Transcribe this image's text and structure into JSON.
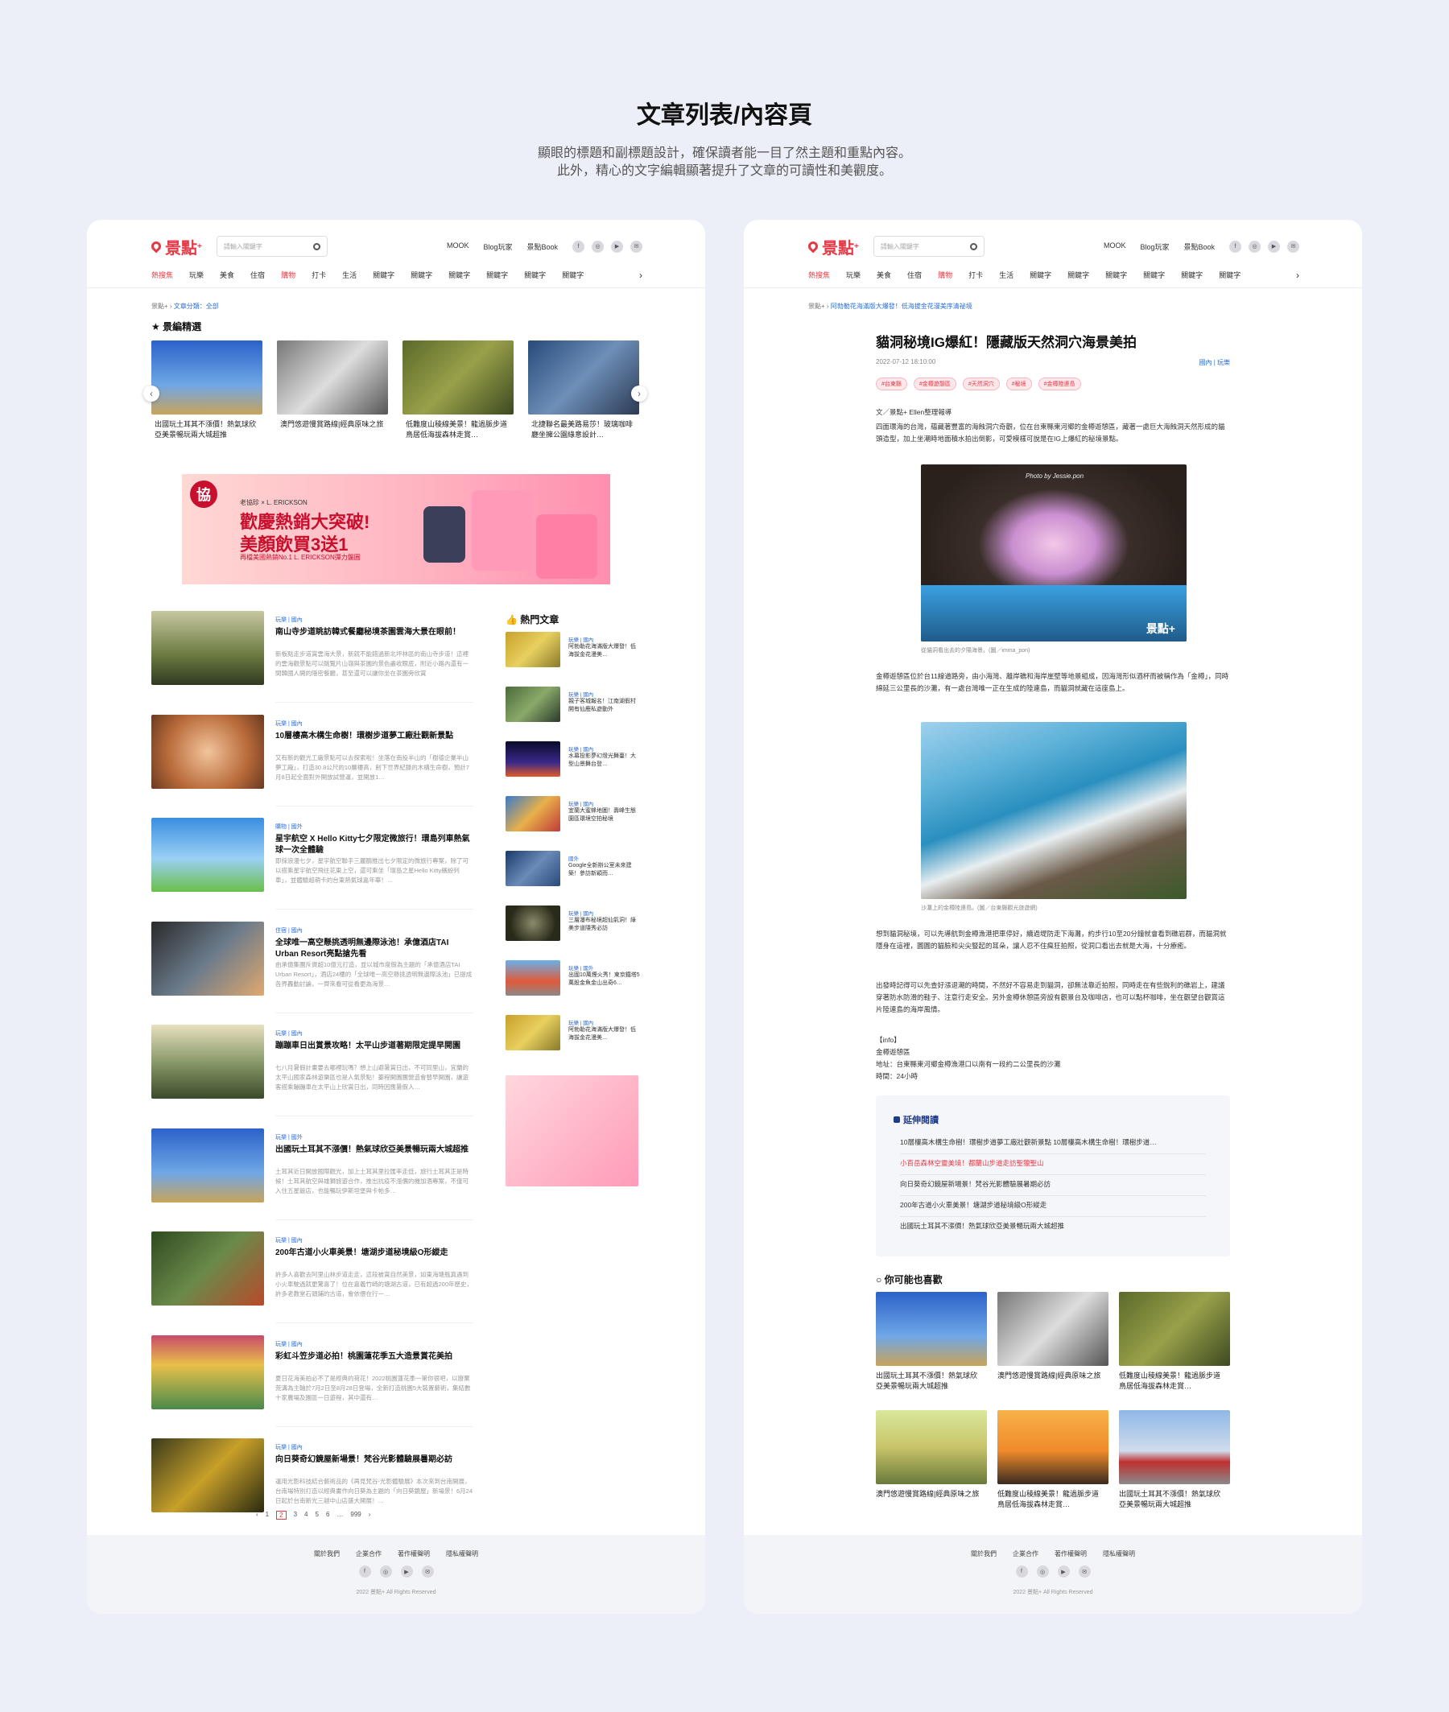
{
  "header": {
    "title": "文章列表/內容頁",
    "desc_line1": "顯眼的標題和副標題設計，確保讀者能一目了然主題和重點內容。",
    "desc_line2": "此外，精心的文字編輯顯著提升了文章的可讀性和美觀度。"
  },
  "site": {
    "logo": "景點",
    "logo_sup": "+",
    "search_placeholder": "請輸入關鍵字",
    "nav_links": [
      "MOOK",
      "Blog玩家",
      "景點Book"
    ],
    "socials": [
      "f",
      "◎",
      "▶",
      "✉"
    ],
    "tabs": [
      "熱搜焦",
      "玩樂",
      "美食",
      "住宿",
      "購物",
      "打卡",
      "生活",
      "關鍵字",
      "關鍵字",
      "關鍵字",
      "關鍵字",
      "關鍵字",
      "關鍵字"
    ],
    "more": "›"
  },
  "list_page": {
    "crumb_home": "景點+",
    "crumb_current": "文章分類：全部",
    "featured_title": "★ 景編精選",
    "featured": [
      "出國玩土耳其不漲價！熱氣球欣亞美景暢玩兩大城超推",
      "澳門悠遊慢賞路線|經典原味之旅",
      "低難度山稜線美景！龍過脈步道鳥居低海拔森林走賞…",
      "北捷聯名最美路易莎！玻璃咖啡廳坐擁公園綠意設計…"
    ],
    "banner": {
      "logo": "協",
      "brand": "老協珍 × L. ERICKSON",
      "line1": "歡慶熱銷大突破!",
      "line2": "美顏飲買3送1",
      "line3": "再檔美國熱銷No.1 L. ERICKSON彈力盤圓"
    },
    "articles": [
      {
        "meta": "玩樂 | 國內",
        "title": "南山寺步道眺訪韓式餐廳秘境茶園雲海大景在眼前！",
        "excerpt": "新板點走步道賞雲海大景，新就不能錯過新北坪林區的南山寺步道！這裡的雲海觀景點可以眺覽片山嶺與茶園的景色盡收眼底，附近小路內還有一間韓國人開的隱密餐廳，甚至還可以讓你坐在茶園旁欣賞"
      },
      {
        "meta": "玩樂 | 國內",
        "title": "10層樓高木構生命樹！環樹步道夢工廠壯觀新景點",
        "excerpt": "又有新的觀光工廠景點可以去探索啦！坐落在南投半山的「樹德企業半山夢工廠」，打造30.8公尺的10層樓高，創下世界紀錄的木構生命樹，預計7月8日起全面對外開放試營運，並開放1…"
      },
      {
        "meta": "購物 | 國外",
        "title": "星宇航空 X Hello Kitty七夕限定微旅行！環島列車熱氣球一次全體驗",
        "excerpt": "即採浪漫七夕，星宇航空聯手三麗鷗推出七夕限定的微旅行專案，除了可以搭乘星宇航空飛往花東上空，還可乘坐「環島之星Hello Kitty繽紛列車」，並體驗超萌卡的台東熱氣球嘉年華！…"
      },
      {
        "meta": "住宿 | 國內",
        "title": "全球唯一高空懸挑透明無邊際泳池！承億酒店TAI Urban Resort亮點搶先看",
        "excerpt": "由承億集團斥資超10億元打造，並以城市度假為主題的「承億酒店TAI Urban Resort」，酒店24樓的「全球唯一高空懸挑透明無邊際泳池」已提成各界轟動討論，一齊來看可從看更為海景…"
      },
      {
        "meta": "玩樂 | 國內",
        "title": "蹦蹦車日出賞景攻略！太平山步道著期限定提早開園",
        "excerpt": "七八月暑假計畫要去哪裡玩嗎？想上山避暑賞日出，不可同里山，宜蘭的太平山國家森林遊樂區也是人氣景點！蓁程開園團營造會替早開園，讓遊客搭乘蹦蹦車在太平山上欣賞日出，同時因應暑假人…"
      },
      {
        "meta": "玩樂 | 國外",
        "title": "出國玩土耳其不漲價！熱氣球欣亞美景暢玩兩大城超推",
        "excerpt": "土耳其近日開放國際觀光，加上土耳其里拉匯率走低，旅行土耳其正是時候！土耳其航空與雄獅旅遊合作，推出抗疫不漲價的機加酒專案，不僅可入住五星飯店，也能暢玩伊斯坦堡與卡帕多…"
      },
      {
        "meta": "玩樂 | 國內",
        "title": "200年古道小火車美景！塘湖步道秘境級O形縱走",
        "excerpt": "許多人喜歡去阿里山林步道走走，這段被賞自然美景，如東海塘瓶真遇到小火車駛過就更驚喜了！位在嘉義竹崎的塘湖古道，已有超過200年歷史，許多老教堂石頭鋪的古道，會依偎在行一…"
      },
      {
        "meta": "玩樂 | 國內",
        "title": "彩虹斗笠步道必拍！桃園蓮花季五大造景賞花美拍",
        "excerpt": "夏日花海美拍必不了是經典的荷花！2022桃園蓮花季一第你很吧，以廢棄荒溝為主軸於7月2日至8月28日登場，全新打造桃園5大裝置藝術，集結數十家農場及園區一日遊程，其中還有…"
      },
      {
        "meta": "玩樂 | 國內",
        "title": "向日葵奇幻鏡屋新場景！梵谷光影體驗展暑期必訪",
        "excerpt": "運用光影科技結合藝術品的《再見梵谷-光影體驗展》本次來到台南開展，台南場特別打造以經典畫作向日葵為主題的「向日葵鏡屋」新場景！6月24日起於台南新光三越中山店盛大開展！…"
      }
    ],
    "hot_title": "熱門文章",
    "hot": [
      {
        "meta": "玩樂 | 國內",
        "title": "阿勃勒花海滿版大爆發！低海拔金花漫美…"
      },
      {
        "meta": "玩樂 | 國內",
        "title": "親子客城報名！江南湖假村開有仙鹿私遊動外"
      },
      {
        "meta": "玩樂 | 國內",
        "title": "水幕投影夢幻燈光舞臺！大型山景舞台登…"
      },
      {
        "meta": "玩樂 | 國內",
        "title": "宜蘭大蜜蜂地圖！壽峰生態園區環境空拍秘境"
      },
      {
        "meta": "國外",
        "title": "Google全新辦公室未來建築！參訪新穎而…"
      },
      {
        "meta": "玩樂 | 國內",
        "title": "三層瀑布秘境超仙氣洞！綠美步道隱秀必訪"
      },
      {
        "meta": "玩樂 | 國外",
        "title": "出國10萬煙火秀！東京鐵塔5萬股金魚金山出奇6…"
      },
      {
        "meta": "玩樂 | 國內",
        "title": "阿勃勒花海滿版大爆發！低海拔金花漫美…"
      }
    ],
    "pager": [
      "‹",
      "1",
      "2",
      "3",
      "4",
      "5",
      "6",
      "…",
      "999",
      "›"
    ]
  },
  "article_page": {
    "crumb_home": "景點+",
    "crumb_current": "阿勃勒花海滿版大爆發！低海拔金花漫美序清祕境",
    "title": "貓洞秘境IG爆紅！隱藏版天然洞穴海景美拍",
    "date": "2022-07-12 18:10:00",
    "category": "國內 | 玩樂",
    "tags": [
      "#台東縣",
      "#金樽遊憩區",
      "#天然洞穴",
      "#秘境",
      "#金樽陸連島"
    ],
    "byline": "文／景點+ Ellen整理報導",
    "p1": "四面環海的台灣，蘊藏著豐富的海蝕洞穴奇觀，位在台東縣東河鄉的金樽遊憩區，藏著一處巨大海蝕洞天然形成的貓頭造型，加上坐潮時地面積水拍出倒影，可愛模樣可說是在IG上爆紅的秘境景點。",
    "img1_watermark": "Photo by Jessie.pon",
    "img1_logo": "景點+",
    "cap1": "從貓洞看出去的夕陽海景。(圖／imma_pon)",
    "p2": "金樽遊憩區位於台11線道路旁，由小海灣、離岸礁和海岸崖壁等地景組成，因海灣形似酒杯而被稱作為「金樽」，同時綿延三公里長的沙灘，有一處台灣唯一正在生成的陸連島，而貓洞就藏在這座島上。",
    "cap2": "沙灘上的金樽陸連島。(圖／台東縣觀光旅遊網)",
    "p3": "想到貓洞秘境，可以先導航到金樽漁港把車停好，續過堤防走下海灘，約步行10至20分鐘就會看到礁岩群，而貓洞就隱身在這裡，圓圓的貓臉和尖尖豎起的耳朵，讓人忍不住瘋狂拍照，從洞口看出去就是大海，十分療癒。",
    "p4": "出發時記得可以先查好漲退潮的時間，不然好不容易走到貓洞，卻無法靠近拍照，同時走在有些銳利的礁岩上，建議穿著防水防滑的鞋子、注意行走安全。另外金樽休憩區旁設有觀景台及咖啡店，也可以點杯咖啡，坐在觀望台觀賞這片陸連島的海岸風情。",
    "info_head": "【info】",
    "info_name": "金樽遊憩區",
    "info_addr": "地址：台東縣東河鄉金樽漁港口以南有一段約二公里長的沙灘",
    "info_time": "時間：24小時",
    "ext_title": "延伸閱讀",
    "ext_items": [
      "10層樓高木構生命樹！環樹步道夢工廠壯觀新景點 10層樓高木構生命樹！環樹步道…",
      "小百岳森林空靈美境！都蘭山步道走訪聖獵聖山",
      "向日葵奇幻鏡屋新場景！梵谷光影體驗展暑期必訪",
      "200年古道小火車美景！塘湖步道秘境級O形縱走",
      "出國玩土耳其不漲價！熱氣球欣亞美景暢玩兩大城超推"
    ],
    "like_title": "你可能也喜歡",
    "like_items": [
      "出國玩土耳其不漲價！熱氣球欣亞美景暢玩兩大城超推",
      "澳門悠遊慢賞路線|經典原味之旅",
      "低難度山稜線美景！龍過脈步道鳥居低海拔森林走賞…",
      "澳門悠遊慢賞路線|經典原味之旅",
      "低難度山稜線美景！龍過脈步道鳥居低海拔森林走賞…",
      "出國玩土耳其不漲價！熱氣球欣亞美景暢玩兩大城超推"
    ]
  },
  "footer": {
    "links": [
      "關於我們",
      "企業合作",
      "著作權聲明",
      "隱私權聲明"
    ],
    "copyright": "2022 景點+ All Rights Reserved"
  }
}
